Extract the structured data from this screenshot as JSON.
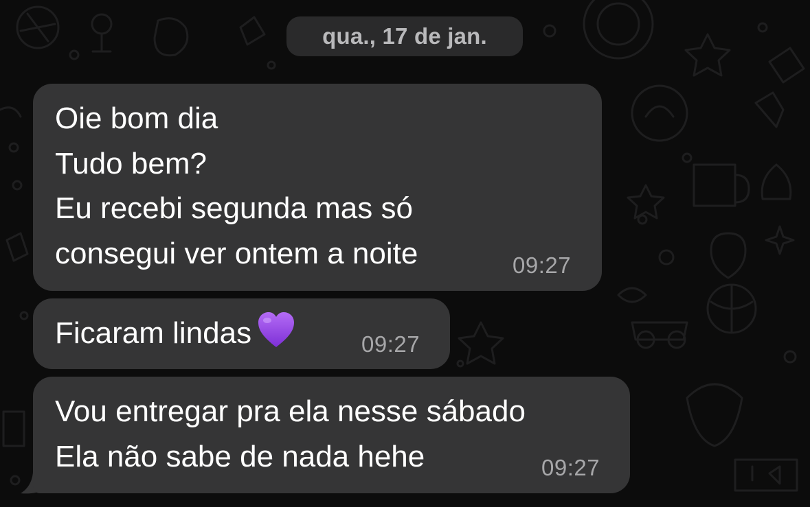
{
  "date_separator": "qua., 17 de jan.",
  "messages": [
    {
      "lines": [
        "Oie bom dia",
        "Tudo bem?",
        "Eu recebi segunda mas só",
        "consegui ver ontem a noite"
      ],
      "time": "09:27"
    },
    {
      "text": "Ficaram lindas",
      "emoji": "purple-heart",
      "time": "09:27"
    },
    {
      "lines": [
        "Vou entregar pra ela nesse sábado",
        "Ela não sabe de nada hehe"
      ],
      "time": "09:27"
    }
  ],
  "colors": {
    "background": "#0c0c0c",
    "bubble": "#353536",
    "date_pill": "#2a2a2b",
    "timestamp": "#a7a7a9",
    "heart": "#9b45e8"
  }
}
